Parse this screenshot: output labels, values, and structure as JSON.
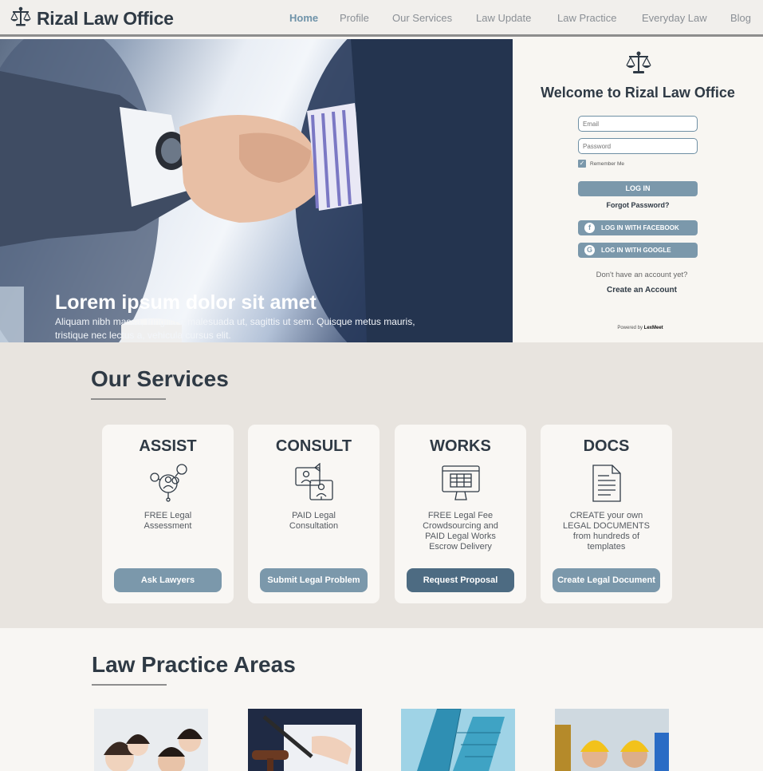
{
  "header": {
    "logo_text": "Rizal Law Office",
    "logo_icon": "scales-of-justice-icon",
    "nav": [
      {
        "label": "Home",
        "active": true
      },
      {
        "label": "Profile",
        "active": false
      },
      {
        "label": "Our Services",
        "active": false
      },
      {
        "label": "Law Update",
        "active": false
      },
      {
        "label": "Law Practice",
        "active": false
      },
      {
        "label": "Everyday Law",
        "active": false
      },
      {
        "label": "Blog",
        "active": false
      }
    ]
  },
  "hero": {
    "title": "Lorem ipsum dolor sit amet",
    "subtitle": "Aliquam nibh massa, fringilla a malesuada ut, sagittis ut sem. Quisque metus mauris, tristique nec lectus a, vehicula cursus elit.",
    "image": "handshake-photo"
  },
  "login": {
    "title": "Welcome to Rizal Law Office",
    "email_placeholder": "Email",
    "password_placeholder": "Password",
    "remember_label": "Remember Me",
    "remember_checked": true,
    "login_label": "LOG IN",
    "forgot_label": "Forgot Password?",
    "facebook_label": "LOG IN WITH FACEBOOK",
    "google_label": "LOG IN WITH GOOGLE",
    "no_account_text": "Don't have an account yet?",
    "create_label": "Create an Account",
    "powered_prefix": "Powered by",
    "powered_brand": "LexMeet"
  },
  "services": {
    "title": "Our Services",
    "cards": [
      {
        "title": "ASSIST",
        "icon": "lawyer-network-icon",
        "desc": "FREE Legal\nAssessment",
        "button": "Ask Lawyers",
        "button_style": "normal"
      },
      {
        "title": "CONSULT",
        "icon": "video-consultation-icon",
        "desc": "PAID Legal\nConsultation",
        "button": "Submit Legal Problem",
        "button_style": "normal"
      },
      {
        "title": "WORKS",
        "icon": "computer-monitor-icon",
        "desc": "FREE Legal Fee\nCrowdsourcing and\nPAID Legal Works\nEscrow Delivery",
        "button": "Request Proposal",
        "button_style": "dark"
      },
      {
        "title": "DOCS",
        "icon": "document-icon",
        "desc": "CREATE your own\nLEGAL DOCUMENTS\nfrom hundreds of\ntemplates",
        "button": "Create Legal Document",
        "button_style": "normal"
      }
    ]
  },
  "practice": {
    "title": "Law Practice Areas",
    "photos": [
      "family-photo",
      "gavel-signing-photo",
      "office-building-photo",
      "construction-workers-photo"
    ]
  },
  "colors": {
    "accent": "#7b98ab",
    "accent_dark": "#4d6b82",
    "nav_active": "#6f93a9",
    "heading": "#2f3a45"
  }
}
